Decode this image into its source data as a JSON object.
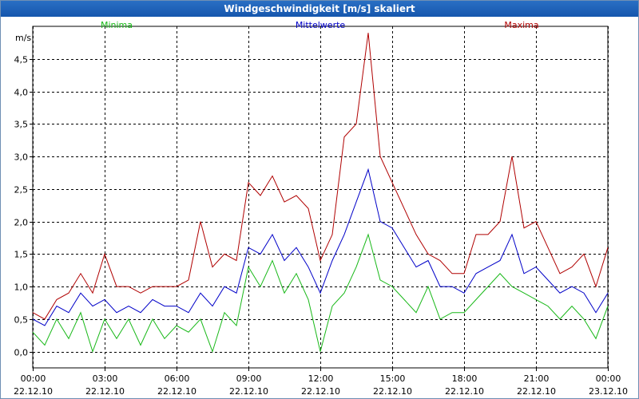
{
  "window": {
    "title": "Windgeschwindigkeit [m/s] skaliert"
  },
  "colors": {
    "min": "#18b818",
    "mean": "#0000c8",
    "max": "#b00000",
    "grid": "#000000",
    "titlebar": "#1f63b8"
  },
  "chart_data": {
    "type": "line",
    "title": "Windgeschwindigkeit [m/s] skaliert",
    "ylabel": "m/s",
    "ylim": [
      -0.25,
      5.0
    ],
    "xlim": [
      0,
      24
    ],
    "y_ticks": [
      {
        "value": 0.0,
        "label": "0,0"
      },
      {
        "value": 0.5,
        "label": "0,5"
      },
      {
        "value": 1.0,
        "label": "1,0"
      },
      {
        "value": 1.5,
        "label": "1,5"
      },
      {
        "value": 2.0,
        "label": "2,0"
      },
      {
        "value": 2.5,
        "label": "2,5"
      },
      {
        "value": 3.0,
        "label": "3,0"
      },
      {
        "value": 3.5,
        "label": "3,5"
      },
      {
        "value": 4.0,
        "label": "4,0"
      },
      {
        "value": 4.5,
        "label": "4,5"
      }
    ],
    "x_ticks": [
      {
        "value": 0,
        "time": "00:00",
        "date": "22.12.10"
      },
      {
        "value": 3,
        "time": "03:00",
        "date": "22.12.10"
      },
      {
        "value": 6,
        "time": "06:00",
        "date": "22.12.10"
      },
      {
        "value": 9,
        "time": "09:00",
        "date": "22.12.10"
      },
      {
        "value": 12,
        "time": "12:00",
        "date": "22.12.10"
      },
      {
        "value": 15,
        "time": "15:00",
        "date": "22.12.10"
      },
      {
        "value": 18,
        "time": "18:00",
        "date": "22.12.10"
      },
      {
        "value": 21,
        "time": "21:00",
        "date": "22.12.10"
      },
      {
        "value": 24,
        "time": "00:00",
        "date": "23.12.10"
      }
    ],
    "grid": true,
    "legend": "top",
    "series": [
      {
        "name": "Minima",
        "color": "#18b818",
        "legend_pos": "left",
        "x": [
          0,
          0.5,
          1,
          1.5,
          2,
          2.5,
          3,
          3.5,
          4,
          4.5,
          5,
          5.5,
          6,
          6.5,
          7,
          7.5,
          8,
          8.5,
          9,
          9.5,
          10,
          10.5,
          11,
          11.5,
          12,
          12.5,
          13,
          13.5,
          14,
          14.5,
          15,
          15.5,
          16,
          16.5,
          17,
          17.5,
          18,
          18.5,
          19,
          19.5,
          20,
          20.5,
          21,
          21.5,
          22,
          22.5,
          23,
          23.5,
          24
        ],
        "values": [
          0.3,
          0.1,
          0.5,
          0.2,
          0.6,
          0.0,
          0.5,
          0.2,
          0.5,
          0.1,
          0.5,
          0.2,
          0.4,
          0.3,
          0.5,
          0.0,
          0.6,
          0.4,
          1.3,
          1.0,
          1.4,
          0.9,
          1.2,
          0.8,
          0.0,
          0.7,
          0.9,
          1.3,
          1.8,
          1.1,
          1.0,
          0.8,
          0.6,
          1.0,
          0.5,
          0.6,
          0.6,
          0.8,
          1.0,
          1.2,
          1.0,
          0.9,
          0.8,
          0.7,
          0.5,
          0.7,
          0.5,
          0.2,
          0.7
        ]
      },
      {
        "name": "Mittelwerte",
        "color": "#0000c8",
        "legend_pos": "center",
        "x": [
          0,
          0.5,
          1,
          1.5,
          2,
          2.5,
          3,
          3.5,
          4,
          4.5,
          5,
          5.5,
          6,
          6.5,
          7,
          7.5,
          8,
          8.5,
          9,
          9.5,
          10,
          10.5,
          11,
          11.5,
          12,
          12.5,
          13,
          13.5,
          14,
          14.5,
          15,
          15.5,
          16,
          16.5,
          17,
          17.5,
          18,
          18.5,
          19,
          19.5,
          20,
          20.5,
          21,
          21.5,
          22,
          22.5,
          23,
          23.5,
          24
        ],
        "values": [
          0.5,
          0.4,
          0.7,
          0.6,
          0.9,
          0.7,
          0.8,
          0.6,
          0.7,
          0.6,
          0.8,
          0.7,
          0.7,
          0.6,
          0.9,
          0.7,
          1.0,
          0.9,
          1.6,
          1.5,
          1.8,
          1.4,
          1.6,
          1.3,
          0.9,
          1.4,
          1.8,
          2.3,
          2.8,
          2.0,
          1.9,
          1.6,
          1.3,
          1.4,
          1.0,
          1.0,
          0.9,
          1.2,
          1.3,
          1.4,
          1.8,
          1.2,
          1.3,
          1.1,
          0.9,
          1.0,
          0.9,
          0.6,
          0.9
        ]
      },
      {
        "name": "Maxima",
        "color": "#b00000",
        "legend_pos": "right",
        "x": [
          0,
          0.5,
          1,
          1.5,
          2,
          2.5,
          3,
          3.5,
          4,
          4.5,
          5,
          5.5,
          6,
          6.5,
          7,
          7.5,
          8,
          8.5,
          9,
          9.5,
          10,
          10.5,
          11,
          11.5,
          12,
          12.5,
          13,
          13.5,
          14,
          14.5,
          15,
          15.5,
          16,
          16.5,
          17,
          17.5,
          18,
          18.5,
          19,
          19.5,
          20,
          20.5,
          21,
          21.5,
          22,
          22.5,
          23,
          23.5,
          24
        ],
        "values": [
          0.6,
          0.5,
          0.8,
          0.9,
          1.2,
          0.9,
          1.5,
          1.0,
          1.0,
          0.9,
          1.0,
          1.0,
          1.0,
          1.1,
          2.0,
          1.3,
          1.5,
          1.4,
          2.6,
          2.4,
          2.7,
          2.3,
          2.4,
          2.2,
          1.4,
          1.8,
          3.3,
          3.5,
          4.9,
          3.0,
          2.6,
          2.2,
          1.8,
          1.5,
          1.4,
          1.2,
          1.2,
          1.8,
          1.8,
          2.0,
          3.0,
          1.9,
          2.0,
          1.6,
          1.2,
          1.3,
          1.5,
          1.0,
          1.6
        ]
      }
    ]
  }
}
